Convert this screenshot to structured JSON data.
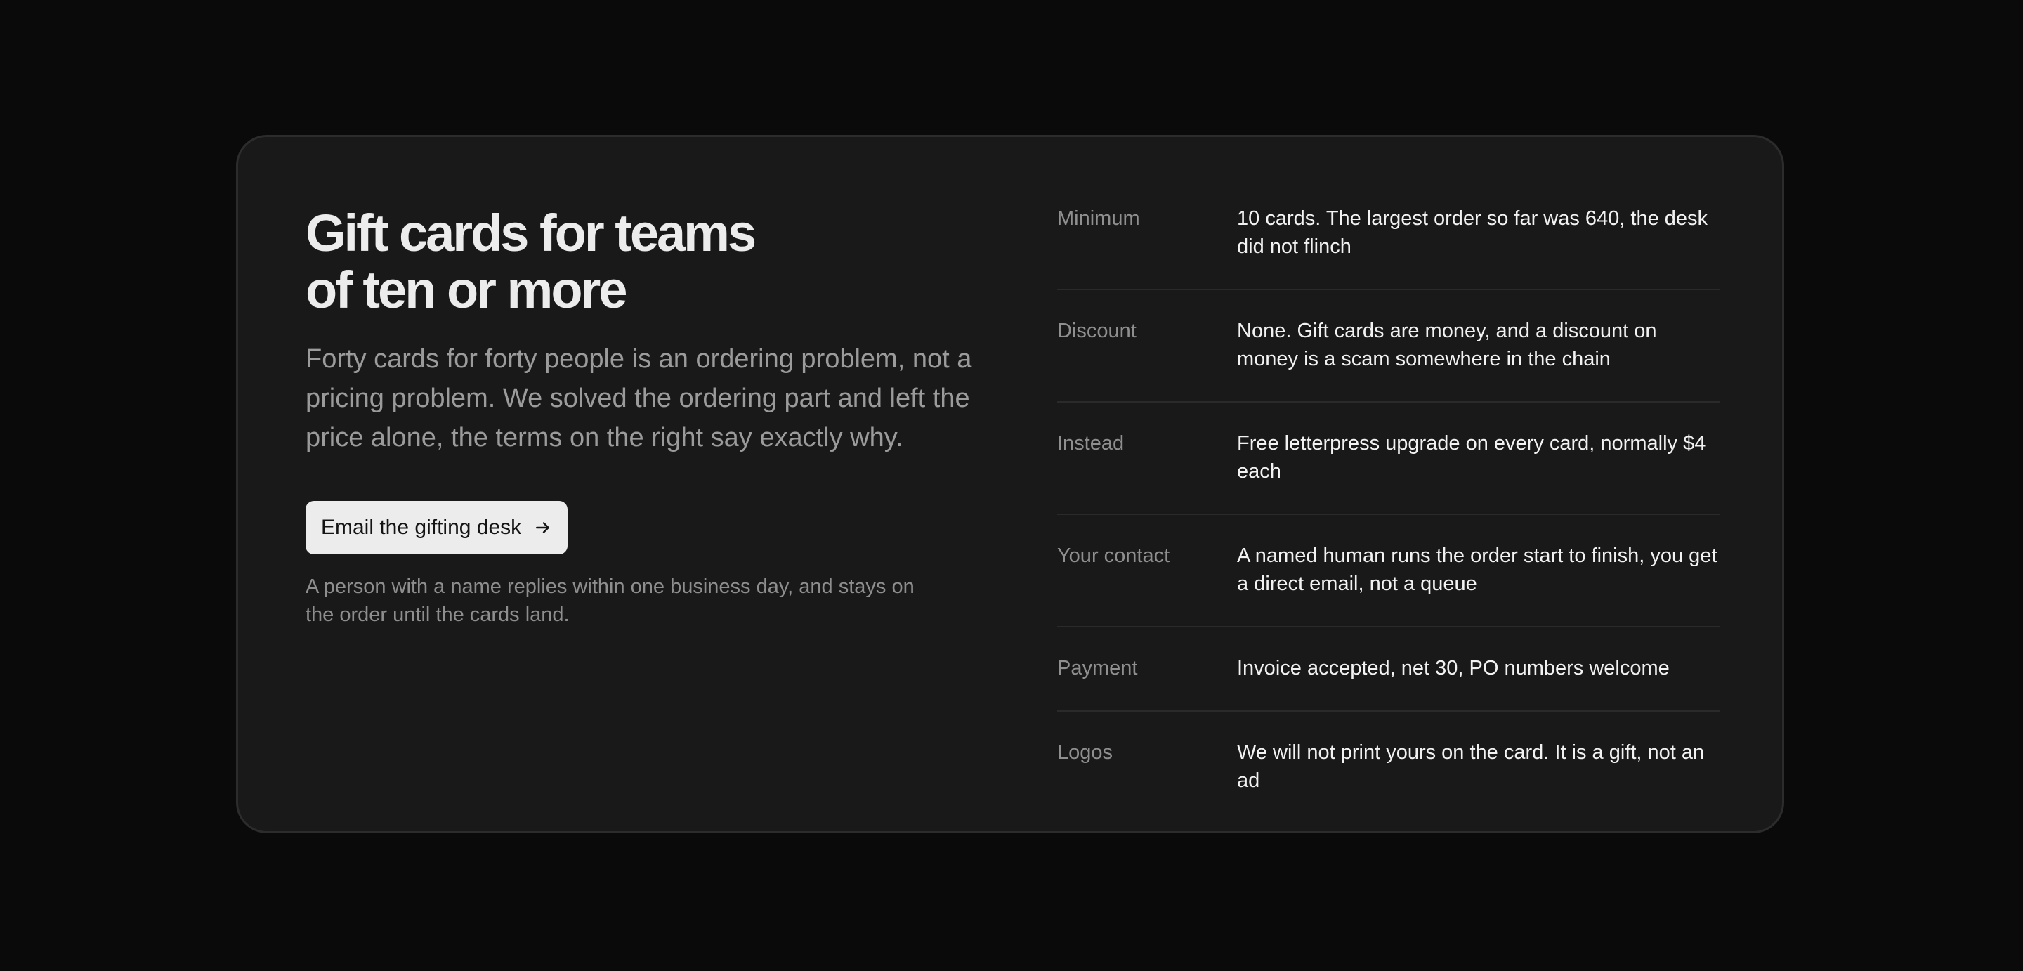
{
  "hero": {
    "title_line1": "Gift cards for teams",
    "title_line2": "of ten or more",
    "lede": "Forty cards for forty people is an ordering problem, not a pricing problem. We solved the ordering part and left the price alone, the terms on the right say exactly why.",
    "cta_label": "Email the gifting desk",
    "cta_icon": "arrow-right-icon",
    "note": "A person with a name replies within one business day, and stays on the order until the cards land."
  },
  "terms": [
    {
      "label": "Minimum",
      "value": "10 cards. The largest order so far was 640, the desk did not flinch"
    },
    {
      "label": "Discount",
      "value": "None. Gift cards are money, and a discount on money is a scam somewhere in the chain"
    },
    {
      "label": "Instead",
      "value": "Free letterpress upgrade on every card, normally $4 each"
    },
    {
      "label": "Your contact",
      "value": "A named human runs the order start to finish, you get a direct email, not a queue"
    },
    {
      "label": "Payment",
      "value": "Invoice accepted, net 30, PO numbers welcome"
    },
    {
      "label": "Logos",
      "value": "We will not print yours on the card. It is a gift, not an ad"
    }
  ],
  "colors": {
    "page_background": "#0a0a0a",
    "card_background": "#191919",
    "button_background": "#ececec",
    "heading": "#ececec",
    "muted_text": "#9b9b9b"
  }
}
